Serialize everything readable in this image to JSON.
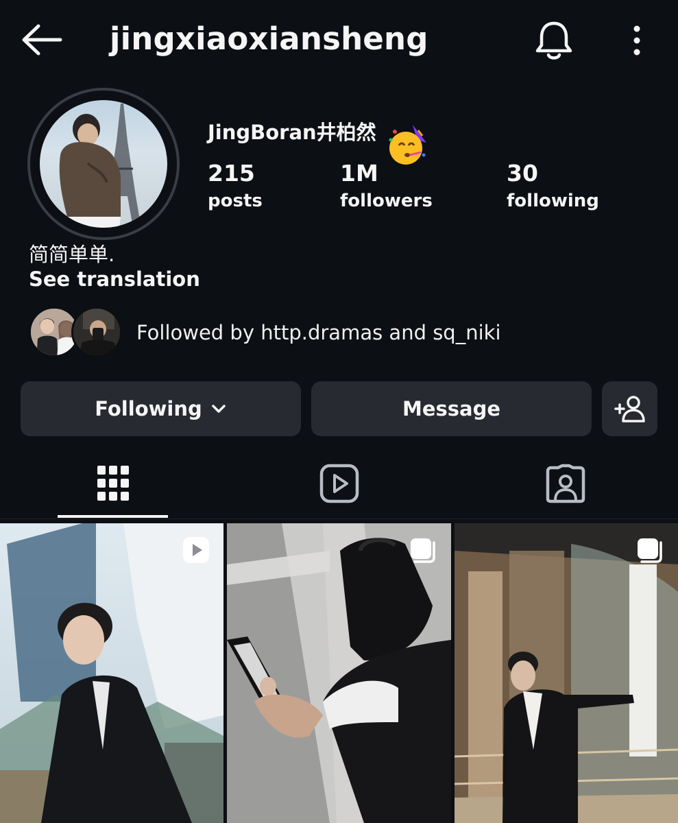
{
  "header": {
    "username": "jingxiaoxiansheng",
    "back_icon": "arrow-left-icon",
    "bell_icon": "bell-icon",
    "more_icon": "kebab-menu-icon"
  },
  "profile": {
    "display_name": "JingBoran井柏然",
    "emoji": "🥳",
    "stats": [
      {
        "value": "215",
        "label": "posts"
      },
      {
        "value": "1M",
        "label": "followers"
      },
      {
        "value": "30",
        "label": "following"
      }
    ],
    "bio": "简简单单.",
    "see_translation": "See translation",
    "followed_by": "Followed by http.dramas and sq_niki"
  },
  "actions": {
    "following_label": "Following",
    "message_label": "Message",
    "add_person_icon": "add-person-icon"
  },
  "tabs": [
    {
      "name": "posts",
      "icon": "grid-icon",
      "active": true
    },
    {
      "name": "reels",
      "icon": "reels-play-icon",
      "active": false
    },
    {
      "name": "tagged",
      "icon": "tagged-person-icon",
      "active": false
    }
  ],
  "grid": [
    {
      "type": "reel",
      "badge_icon": "reel-play-badge-icon"
    },
    {
      "type": "carousel",
      "badge_icon": "carousel-badge-icon"
    },
    {
      "type": "carousel",
      "badge_icon": "carousel-badge-icon"
    }
  ],
  "colors": {
    "background": "#0c0f14",
    "button_bg": "#272a31",
    "text": "#f5f5f5"
  }
}
